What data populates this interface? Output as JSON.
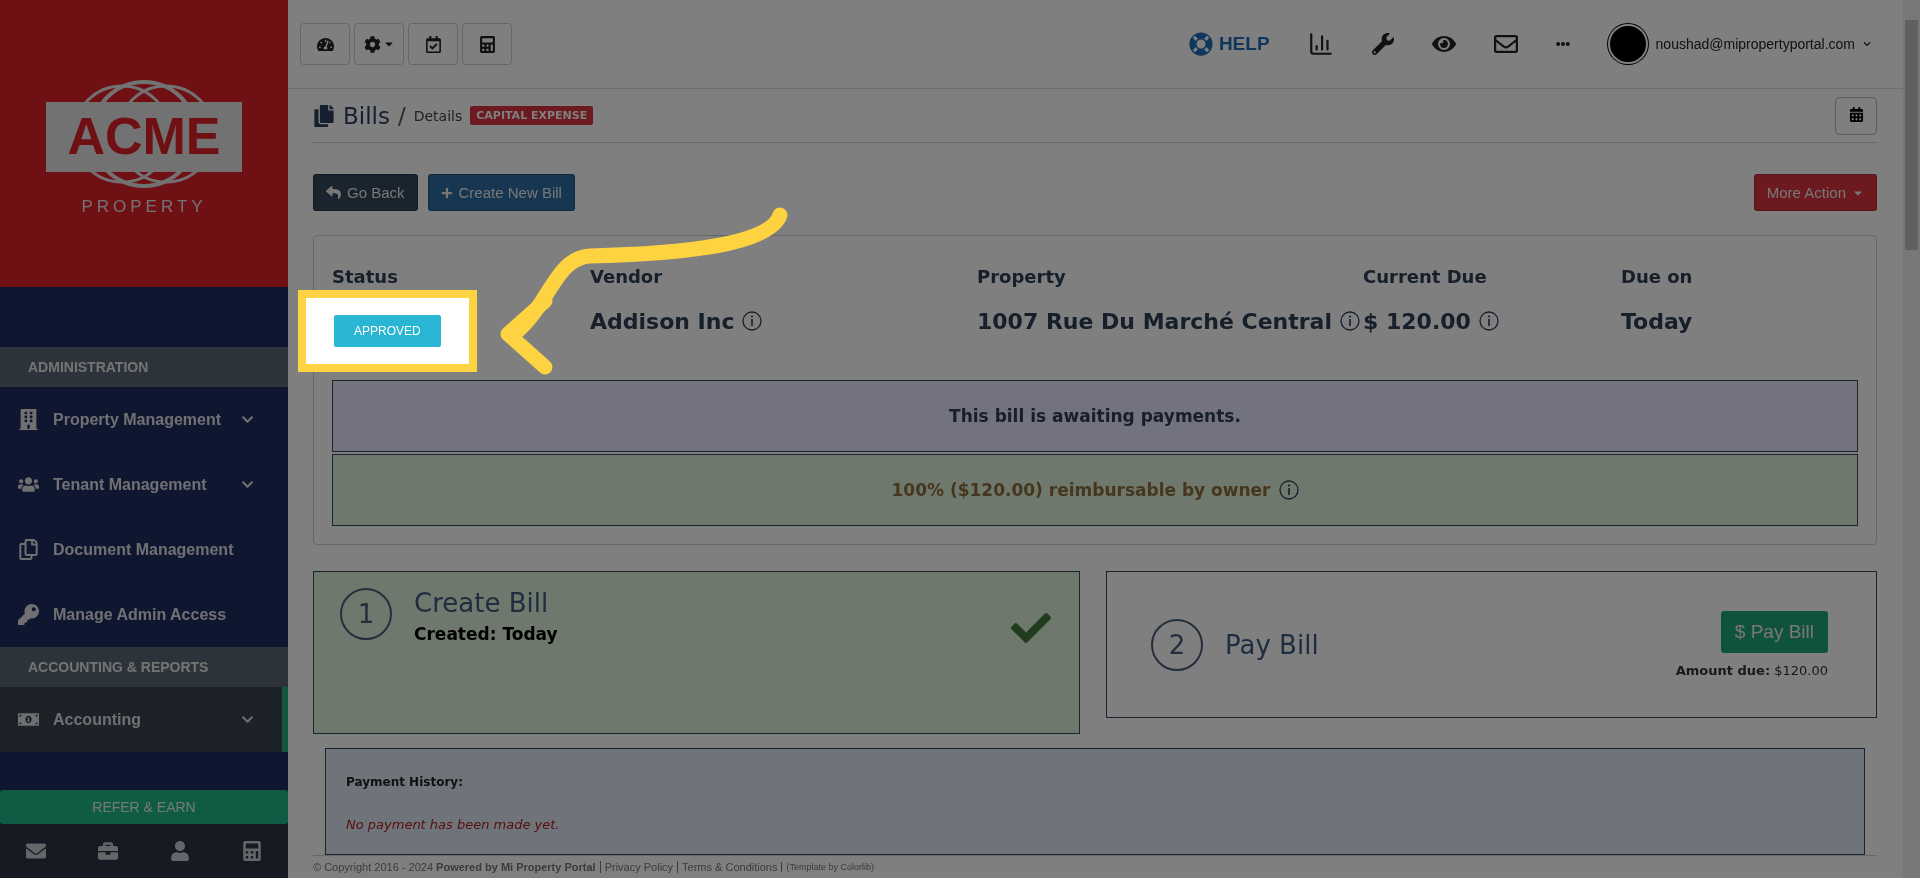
{
  "logo": {
    "name": "ACME",
    "tagline": "PROPERTY"
  },
  "sidebar": {
    "sections": [
      {
        "title": "ADMINISTRATION",
        "items": [
          {
            "label": "Property Management",
            "expandable": true,
            "selected": false
          },
          {
            "label": "Tenant Management",
            "expandable": true,
            "selected": false
          },
          {
            "label": "Document Management",
            "expandable": false,
            "selected": false
          },
          {
            "label": "Manage Admin Access",
            "expandable": false,
            "selected": false
          }
        ]
      },
      {
        "title": "ACCOUNTING & REPORTS",
        "items": [
          {
            "label": "Accounting",
            "expandable": true,
            "selected": true
          }
        ]
      }
    ],
    "refer_button": "REFER & EARN"
  },
  "topbar": {
    "help": "HELP",
    "user": "noushad@mipropertyportal.com"
  },
  "breadcrumb": {
    "title": "Bills",
    "separator": "/",
    "current": "Details",
    "tag": "CAPITAL EXPENSE"
  },
  "actions": {
    "back": "Go Back",
    "create": "Create New Bill",
    "more": "More Action"
  },
  "summary": [
    {
      "label": "Status",
      "kind": "badge",
      "value": "APPROVED",
      "info": false
    },
    {
      "label": "Vendor",
      "kind": "text",
      "value": "Addison Inc",
      "info": true
    },
    {
      "label": "Property",
      "kind": "text",
      "value": "1007 Rue Du Marché Central",
      "info": true
    },
    {
      "label": "Current Due",
      "kind": "text",
      "value": "$ 120.00",
      "info": true
    },
    {
      "label": "Due on",
      "kind": "text",
      "value": "Today",
      "info": false
    }
  ],
  "notices": [
    {
      "text": "This bill is awaiting payments.",
      "kind": "pending",
      "info": false
    },
    {
      "text": "100% ($120.00) reimbursable by owner",
      "kind": "reimburse",
      "info": true
    }
  ],
  "steps": [
    {
      "number": "1",
      "title": "Create Bill",
      "detail": "Created: Today",
      "done": true
    },
    {
      "number": "2",
      "title": "Pay Bill",
      "done": false,
      "button": "$ Pay Bill",
      "amount_label": "Amount due:",
      "amount": "$120.00"
    }
  ],
  "payment_history": {
    "title": "Payment History:",
    "empty": "No payment has been made yet."
  },
  "footer": {
    "copyright": "© Copyright 2016 - 2024",
    "powered": "Powered by Mi Property Portal",
    "links": [
      "Privacy Policy",
      "Terms & Conditions"
    ],
    "credit": "(Template by Colorlib)"
  }
}
